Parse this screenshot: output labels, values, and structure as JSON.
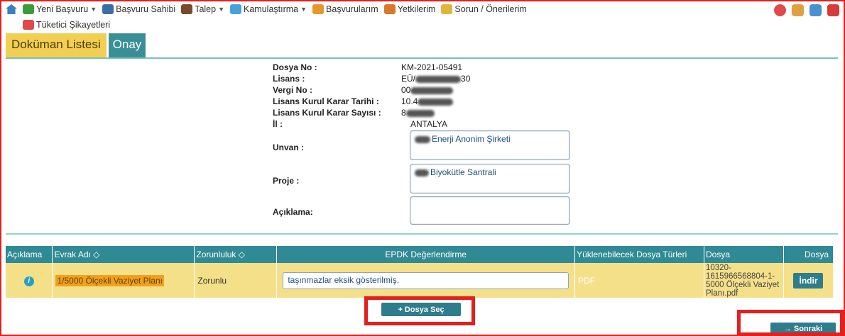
{
  "nav": {
    "row1": [
      {
        "label": "Yeni Başvuru",
        "icon": "new-application-icon",
        "dropdown": true
      },
      {
        "label": "Başvuru Sahibi",
        "icon": "users-icon",
        "dropdown": false
      },
      {
        "label": "Talep",
        "icon": "request-icon",
        "dropdown": true
      },
      {
        "label": "Kamulaştırma",
        "icon": "globe-icon",
        "dropdown": true
      },
      {
        "label": "Başvurularım",
        "icon": "folder-icon",
        "dropdown": false
      },
      {
        "label": "Yetkilerim",
        "icon": "permissions-icon",
        "dropdown": false
      },
      {
        "label": "Sorun / Önerilerim",
        "icon": "chat-icon",
        "dropdown": false
      }
    ],
    "row2": [
      {
        "label": "Tüketici Şikayetleri",
        "icon": "complaint-icon"
      }
    ]
  },
  "tabs": {
    "documents": "Doküman Listesi",
    "approve": "Onay"
  },
  "info": {
    "dosya_no_label": "Dosya No :",
    "dosya_no": "KM-2021-05491",
    "lisans_label": "Lisans :",
    "lisans_prefix": "EÜ/",
    "lisans_suffix": "30",
    "vergi_label": "Vergi No :",
    "vergi_prefix": "00",
    "tarih_label": "Lisans Kurul Karar Tarihi :",
    "tarih_prefix": "10.4",
    "sayi_label": "Lisans Kurul Karar Sayısı :",
    "sayi_prefix": "8",
    "il_label": "İl :",
    "il": "ANTALYA",
    "unvan_label": "Unvan :",
    "unvan": "Enerji Anonim Şirketi",
    "proje_label": "Proje :",
    "proje": "Biyokütle Santrali",
    "aciklama_label": "Açıklama:"
  },
  "table": {
    "headers": [
      "Açıklama",
      "Evrak Adı ◇",
      "Zorunluluk ◇",
      "EPDK Değerlendirme",
      "Yüklenebilecek Dosya Türleri",
      "Dosya",
      "Dosya"
    ],
    "row": {
      "evrak": "1/5000 Ölçekli Vaziyet Planı",
      "zorunluluk": "Zorunlu",
      "epdk": "taşınmazlar eksik gösterilmiş.",
      "tur": "PDF",
      "dosya": "10320-1615966568804-1-5000 Ölçekli Vaziyet Planı.pdf",
      "indir": "İndir"
    }
  },
  "buttons": {
    "dosya_sec": "+ Dosya Seç",
    "sonraki": "→ Sonraki"
  },
  "colors": {
    "accent": "#2f8a95",
    "highlight_box": "#e41f1f",
    "row_bg": "#f5e08a",
    "tab_active": "#f2cf52"
  }
}
